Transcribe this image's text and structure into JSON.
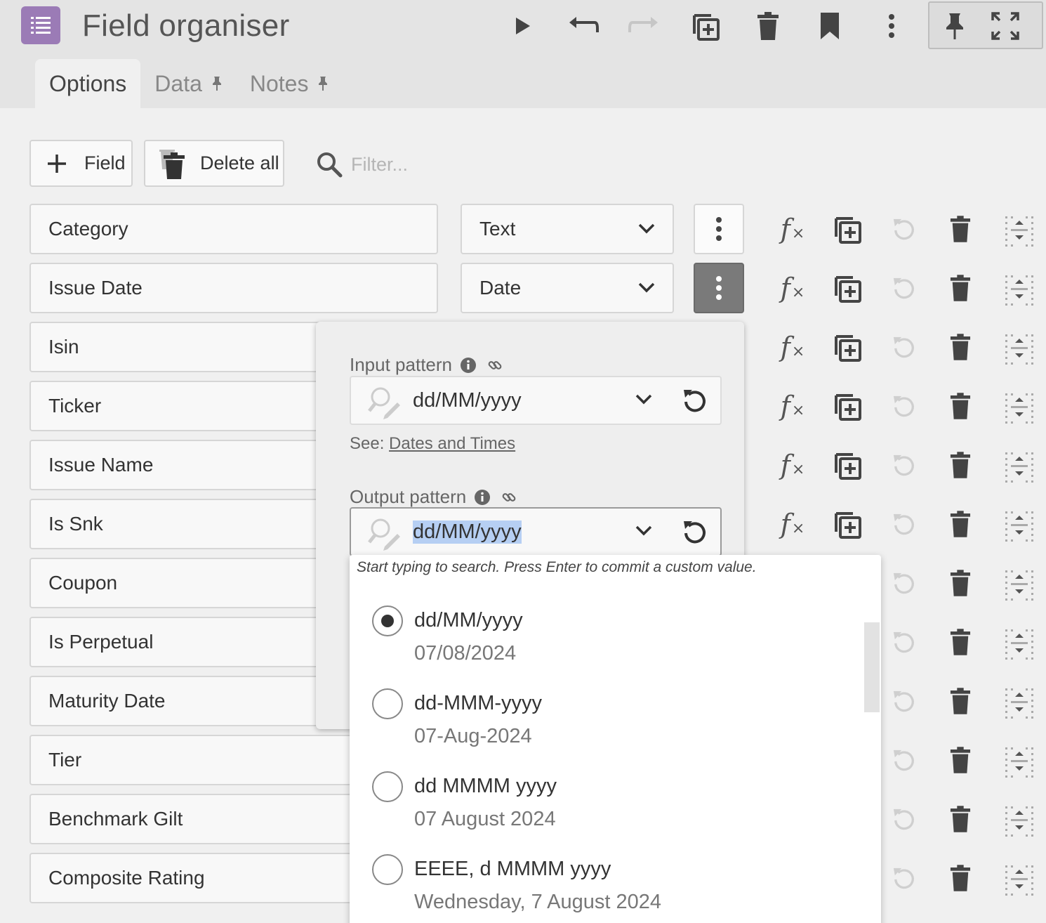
{
  "header": {
    "title": "Field organiser",
    "tabs": [
      {
        "label": "Options",
        "active": true
      },
      {
        "label": "Data",
        "pinned": true
      },
      {
        "label": "Notes",
        "pinned": true
      }
    ]
  },
  "toolbar": {
    "add_field_label": "Field",
    "delete_all_label": "Delete all",
    "filter_placeholder": "Filter..."
  },
  "fields": [
    {
      "name": "Category",
      "type": "Text"
    },
    {
      "name": "Issue Date",
      "type": "Date",
      "menu_open": true
    },
    {
      "name": "Isin"
    },
    {
      "name": "Ticker"
    },
    {
      "name": "Issue Name"
    },
    {
      "name": "Is Snk"
    },
    {
      "name": "Coupon"
    },
    {
      "name": "Is Perpetual"
    },
    {
      "name": "Maturity Date"
    },
    {
      "name": "Tier"
    },
    {
      "name": "Benchmark Gilt"
    },
    {
      "name": "Composite Rating"
    }
  ],
  "panel": {
    "input_pattern_label": "Input pattern",
    "input_pattern_value": "dd/MM/yyyy",
    "see_prefix": "See:",
    "see_link": "Dates and Times",
    "output_pattern_label": "Output pattern",
    "output_pattern_value": "dd/MM/yyyy"
  },
  "dropdown": {
    "hint": "Start typing to search. Press Enter to commit a custom value.",
    "options": [
      {
        "pattern": "dd/MM/yyyy",
        "example": "07/08/2024",
        "selected": true
      },
      {
        "pattern": "dd-MMM-yyyy",
        "example": "07-Aug-2024",
        "selected": false
      },
      {
        "pattern": "dd MMMM yyyy",
        "example": "07 August 2024",
        "selected": false
      },
      {
        "pattern": "EEEE, d MMMM yyyy",
        "example": "Wednesday, 7 August 2024",
        "selected": false
      }
    ]
  },
  "colors": {
    "accent": "#9b7bb6",
    "header_bg": "#e4e4e4",
    "page_bg": "#f0f0f0",
    "selection": "#b6cff3"
  }
}
